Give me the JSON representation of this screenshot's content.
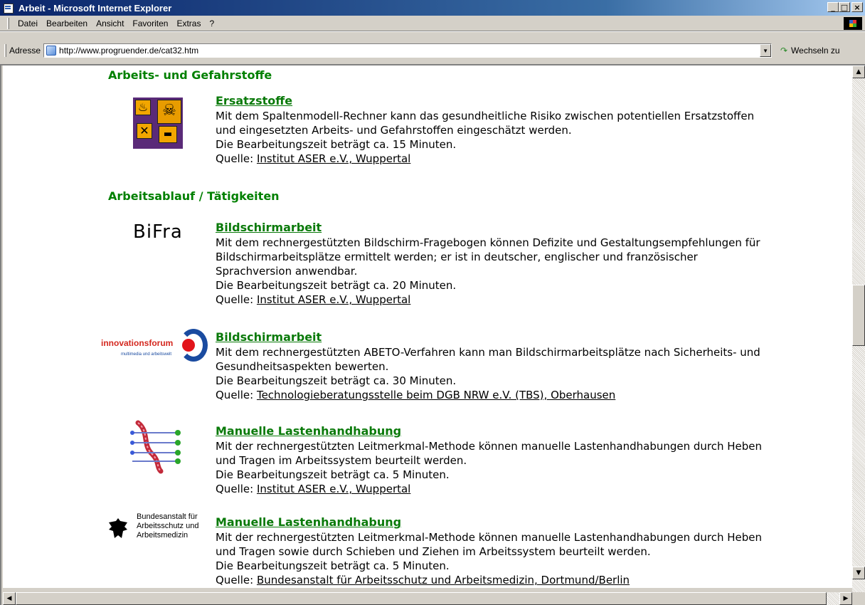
{
  "window": {
    "title": "Arbeit - Microsoft Internet Explorer",
    "controls": {
      "minimize": "_",
      "maximize": "□",
      "close": "×"
    }
  },
  "menu": {
    "items": [
      "Datei",
      "Bearbeiten",
      "Ansicht",
      "Favoriten",
      "Extras",
      "?"
    ]
  },
  "address": {
    "label": "Adresse",
    "url": "http://www.progruender.de/cat32.htm",
    "go_label": "Wechseln zu"
  },
  "page": {
    "sections": [
      {
        "heading": "Arbeits- und Gefahrstoffe",
        "entries": [
          {
            "logo": "hazard-symbols",
            "title": "Ersatzstoffe",
            "lines": [
              "Mit dem Spaltenmodell-Rechner kann das gesundheitliche Risiko zwischen potentiellen Ersatzstoffen",
              "und eingesetzten Arbeits- und Gefahrstoffen eingeschätzt werden.",
              "Die Bearbeitungszeit beträgt ca. 15 Minuten."
            ],
            "source_label": "Quelle:",
            "source": "Institut ASER e.V., Wuppertal"
          }
        ]
      },
      {
        "heading": "Arbeitsablauf / Tätigkeiten",
        "entries": [
          {
            "logo": "bifra",
            "logo_text": "BiFra",
            "title": "Bildschirmarbeit",
            "lines": [
              "Mit dem rechnergestützten Bildschirm-Fragebogen können Defizite und Gestaltungsempfehlungen für",
              "Bildschirmarbeitsplätze ermittelt werden; er ist in deutscher, englischer und französischer",
              "Sprachversion anwendbar.",
              "Die Bearbeitungszeit beträgt ca. 20 Minuten."
            ],
            "source_label": "Quelle:",
            "source": "Institut ASER e.V., Wuppertal"
          },
          {
            "logo": "innovationsforum",
            "logo_text": "innovationsforum",
            "logo_subtext": "multimedia und arbeitswelt",
            "title": "Bildschirmarbeit",
            "lines": [
              "Mit dem rechnergestützten ABETO-Verfahren kann man Bildschirmarbeitsplätze nach Sicherheits- und",
              "Gesundheitsaspekten bewerten.",
              "Die Bearbeitungszeit beträgt ca. 30 Minuten."
            ],
            "source_label": "Quelle:",
            "source": "Technologieberatungsstelle beim DGB NRW e.V. (TBS), Oberhausen"
          },
          {
            "logo": "spine",
            "title": "Manuelle Lastenhandhabung",
            "lines": [
              "Mit der rechnergestützten Leitmerkmal-Methode können manuelle Lastenhandhabungen durch Heben",
              "und Tragen im Arbeitssystem beurteilt werden.",
              "Die Bearbeitungszeit beträgt ca. 5 Minuten."
            ],
            "source_label": "Quelle:",
            "source": "Institut ASER e.V., Wuppertal"
          },
          {
            "logo": "baua",
            "logo_text": [
              "Bundesanstalt für",
              "Arbeitsschutz und",
              "Arbeitsmedizin"
            ],
            "title": "Manuelle Lastenhandhabung",
            "lines": [
              "Mit der rechnergestützten Leitmerkmal-Methode können manuelle Lastenhandhabungen durch Heben",
              "und Tragen sowie durch Schieben und Ziehen im Arbeitssystem beurteilt werden.",
              "Die Bearbeitungszeit beträgt ca. 5 Minuten."
            ],
            "source_label": "Quelle:",
            "source": "Bundesanstalt für Arbeitsschutz und Arbeitsmedizin, Dortmund/Berlin"
          }
        ]
      }
    ]
  },
  "colors": {
    "heading": "#008000",
    "title_link": "#0a7a0a",
    "titlebar_start": "#0a246a",
    "chrome": "#d4d0c8"
  }
}
